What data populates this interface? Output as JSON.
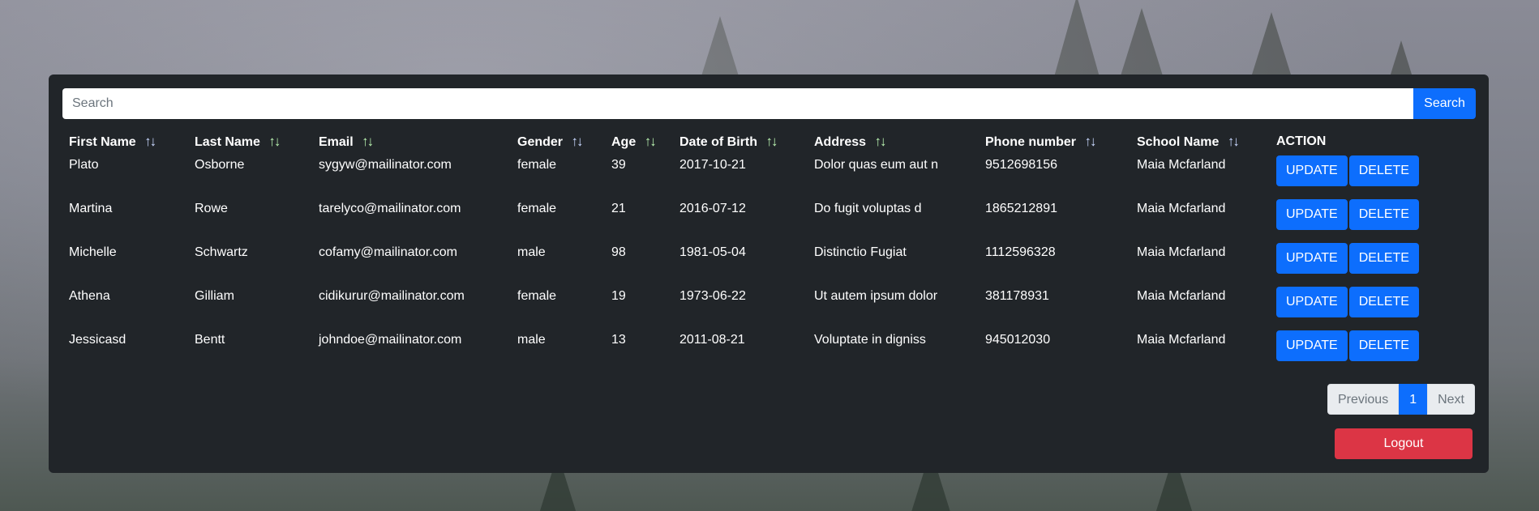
{
  "search": {
    "placeholder": "Search",
    "value": "",
    "button_label": "Search"
  },
  "table": {
    "columns": [
      {
        "label": "First Name",
        "sortable": true
      },
      {
        "label": "Last Name",
        "sortable": true
      },
      {
        "label": "Email",
        "sortable": true
      },
      {
        "label": "Gender",
        "sortable": true
      },
      {
        "label": "Age",
        "sortable": true
      },
      {
        "label": "Date of Birth",
        "sortable": true
      },
      {
        "label": "Address",
        "sortable": true
      },
      {
        "label": "Phone number",
        "sortable": true
      },
      {
        "label": "School Name",
        "sortable": true
      },
      {
        "label": "ACTION",
        "sortable": false
      }
    ],
    "sort_icon": "↑↓",
    "rows": [
      {
        "first_name": "Plato",
        "last_name": "Osborne",
        "email": "sygyw@mailinator.com",
        "gender": "female",
        "age": "39",
        "dob": "2017-10-21",
        "address": "Dolor quas eum aut n",
        "phone": "9512698156",
        "school": "Maia Mcfarland"
      },
      {
        "first_name": "Martina",
        "last_name": "Rowe",
        "email": "tarelyco@mailinator.com",
        "gender": "female",
        "age": "21",
        "dob": "2016-07-12",
        "address": "Do fugit voluptas d",
        "phone": "1865212891",
        "school": "Maia Mcfarland"
      },
      {
        "first_name": "Michelle",
        "last_name": "Schwartz",
        "email": "cofamy@mailinator.com",
        "gender": "male",
        "age": "98",
        "dob": "1981-05-04",
        "address": "Distinctio Fugiat",
        "phone": "1112596328",
        "school": "Maia Mcfarland"
      },
      {
        "first_name": "Athena",
        "last_name": "Gilliam",
        "email": "cidikurur@mailinator.com",
        "gender": "female",
        "age": "19",
        "dob": "1973-06-22",
        "address": "Ut autem ipsum dolor",
        "phone": "381178931",
        "school": "Maia Mcfarland"
      },
      {
        "first_name": "Jessicasd",
        "last_name": "Bentt",
        "email": "johndoe@mailinator.com",
        "gender": "male",
        "age": "13",
        "dob": "2011-08-21",
        "address": "Voluptate in digniss",
        "phone": "945012030",
        "school": "Maia Mcfarland"
      }
    ],
    "update_label": "UPDATE",
    "delete_label": "DELETE"
  },
  "pagination": {
    "previous_label": "Previous",
    "current_page": "1",
    "next_label": "Next"
  },
  "logout_label": "Logout",
  "colors": {
    "panel": "#212529",
    "primary": "#0d6efd",
    "danger": "#dc3545"
  }
}
